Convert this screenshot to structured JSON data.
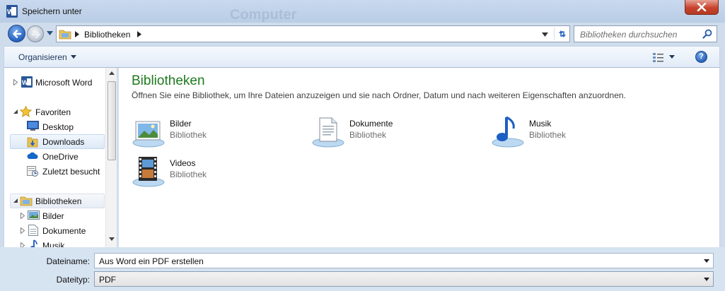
{
  "window": {
    "title": "Speichern unter",
    "ghost_text": "Computer"
  },
  "address": {
    "breadcrumb": [
      "Bibliotheken"
    ]
  },
  "search": {
    "placeholder": "Bibliotheken durchsuchen"
  },
  "toolbar": {
    "organize_label": "Organisieren"
  },
  "nav_pane": {
    "items": [
      {
        "label": "Microsoft Word",
        "icon": "word-icon",
        "level": 0
      },
      {
        "label": "Favoriten",
        "icon": "star-icon",
        "level": 0
      },
      {
        "label": "Desktop",
        "icon": "desktop-icon",
        "level": 1
      },
      {
        "label": "Downloads",
        "icon": "downloads-folder-icon",
        "level": 1,
        "selected": true
      },
      {
        "label": "OneDrive",
        "icon": "onedrive-icon",
        "level": 1
      },
      {
        "label": "Zuletzt besucht",
        "icon": "recent-places-icon",
        "level": 1
      },
      {
        "label": "Bibliotheken",
        "icon": "libraries-icon",
        "level": 0
      },
      {
        "label": "Bilder",
        "icon": "pictures-icon",
        "level": 1
      },
      {
        "label": "Dokumente",
        "icon": "documents-icon",
        "level": 1
      },
      {
        "label": "Musik",
        "icon": "music-icon",
        "level": 1
      }
    ]
  },
  "content": {
    "heading": "Bibliotheken",
    "description": "Öffnen Sie eine Bibliothek, um Ihre Dateien anzuzeigen und sie nach Ordner, Datum und nach weiteren Eigenschaften anzuordnen.",
    "libraries": [
      {
        "name": "Bilder",
        "type": "Bibliothek",
        "icon": "pictures-library-icon"
      },
      {
        "name": "Dokumente",
        "type": "Bibliothek",
        "icon": "documents-library-icon"
      },
      {
        "name": "Musik",
        "type": "Bibliothek",
        "icon": "music-library-icon"
      },
      {
        "name": "Videos",
        "type": "Bibliothek",
        "icon": "videos-library-icon"
      }
    ]
  },
  "form": {
    "filename_label": "Dateiname:",
    "filename_value": "Aus Word ein PDF erstellen",
    "filetype_label": "Dateityp:",
    "filetype_value": "PDF"
  },
  "colors": {
    "heading_green": "#1e7a1e",
    "window_frame": "#cfdceb",
    "close_red": "#c8442f"
  }
}
